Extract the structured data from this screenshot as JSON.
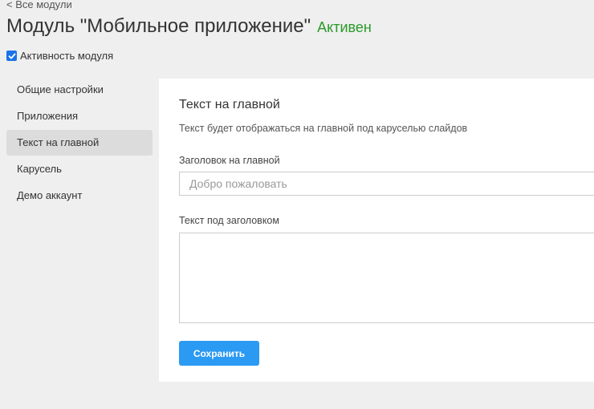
{
  "header": {
    "back_link": "< Все модули",
    "title": "Модуль \"Мобильное приложение\"",
    "status": "Активен",
    "activity_label": "Активность модуля",
    "activity_checked": true
  },
  "sidebar": {
    "items": [
      {
        "label": "Общие настройки",
        "active": false
      },
      {
        "label": "Приложения",
        "active": false
      },
      {
        "label": "Текст на главной",
        "active": true
      },
      {
        "label": "Карусель",
        "active": false
      },
      {
        "label": "Демо аккаунт",
        "active": false
      }
    ]
  },
  "main": {
    "section_title": "Текст на главной",
    "section_description": "Текст будет отображаться на главной под каруселью слайдов",
    "heading_field": {
      "label": "Заголовок на главной",
      "value": "",
      "placeholder": "Добро пожаловать"
    },
    "text_field": {
      "label": "Текст под заголовком",
      "value": "",
      "placeholder": ""
    },
    "save_label": "Сохранить"
  },
  "colors": {
    "status": "#2a9a2a",
    "checkbox": "#1a73e8",
    "save_button": "#2b9af3",
    "active_sidebar": "#dcdcdc"
  },
  "icons": {
    "checkbox": "checkmark-icon"
  }
}
